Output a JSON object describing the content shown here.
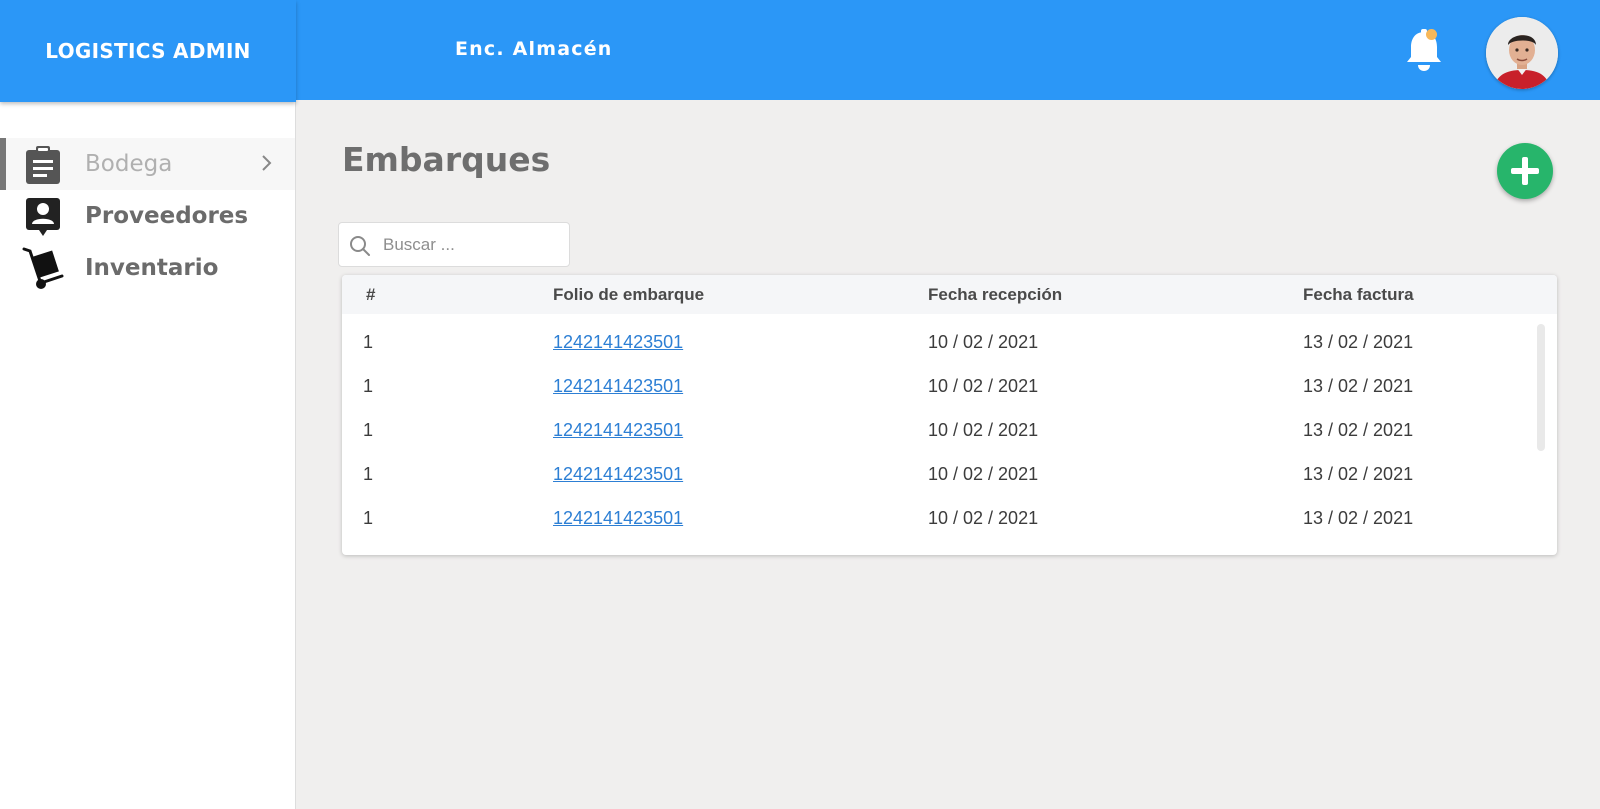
{
  "brand": {
    "title": "LOGISTICS ADMIN"
  },
  "header": {
    "role": "Enc. Almacén",
    "notification_dot_color": "#f7b85a"
  },
  "sidebar": {
    "items": [
      {
        "label": "Bodega",
        "icon": "clipboard-icon",
        "active": true
      },
      {
        "label": "Proveedores",
        "icon": "contact-card-icon",
        "active": false
      },
      {
        "label": "Inventario",
        "icon": "hand-truck-icon",
        "active": false
      }
    ]
  },
  "main": {
    "title": "Embarques",
    "search": {
      "placeholder": "Buscar ..."
    },
    "table": {
      "headers": [
        "#",
        "Folio de embarque",
        "Fecha recepción",
        "Fecha factura"
      ],
      "rows": [
        [
          "1",
          "1242141423501",
          "10 / 02 / 2021",
          "13 / 02 / 2021"
        ],
        [
          "1",
          "1242141423501",
          "10 / 02 / 2021",
          "13 / 02 / 2021"
        ],
        [
          "1",
          "1242141423501",
          "10 / 02 / 2021",
          "13 / 02 / 2021"
        ],
        [
          "1",
          "1242141423501",
          "10 / 02 / 2021",
          "13 / 02 / 2021"
        ],
        [
          "1",
          "1242141423501",
          "10 / 02 / 2021",
          "13 / 02 / 2021"
        ]
      ]
    }
  },
  "colors": {
    "primary": "#2b97f7",
    "add_button": "#27b56b",
    "link": "#2d7fd4"
  }
}
